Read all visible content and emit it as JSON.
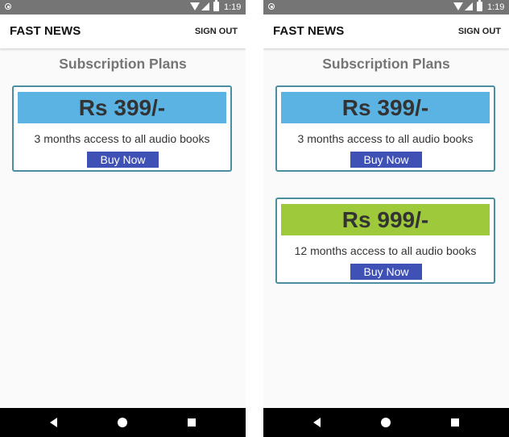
{
  "status_bar": {
    "time": "1:19",
    "icons": [
      "notification-dot-icon",
      "wifi-icon",
      "signal-icon",
      "battery-icon"
    ]
  },
  "toolbar": {
    "title": "FAST NEWS",
    "sign_out_label": "SIGN OUT"
  },
  "page": {
    "title": "Subscription Plans"
  },
  "screens": [
    {
      "plans": [
        {
          "price": "Rs 399/-",
          "description": "3 months access to all audio books",
          "button_label": "Buy Now",
          "color": "#5bb3e3"
        }
      ]
    },
    {
      "plans": [
        {
          "price": "Rs 399/-",
          "description": "3 months access to all audio books",
          "button_label": "Buy Now",
          "color": "#5bb3e3"
        },
        {
          "price": "Rs 999/-",
          "description": "12 months access to all audio books",
          "button_label": "Buy Now",
          "color": "#9dc93a"
        }
      ]
    }
  ],
  "nav_bar": {
    "icons": [
      "back-icon",
      "home-icon",
      "recents-icon"
    ]
  },
  "colors": {
    "accent": "#3f51b5",
    "card_border": "#4a8ea0",
    "status_bar": "#757575"
  }
}
